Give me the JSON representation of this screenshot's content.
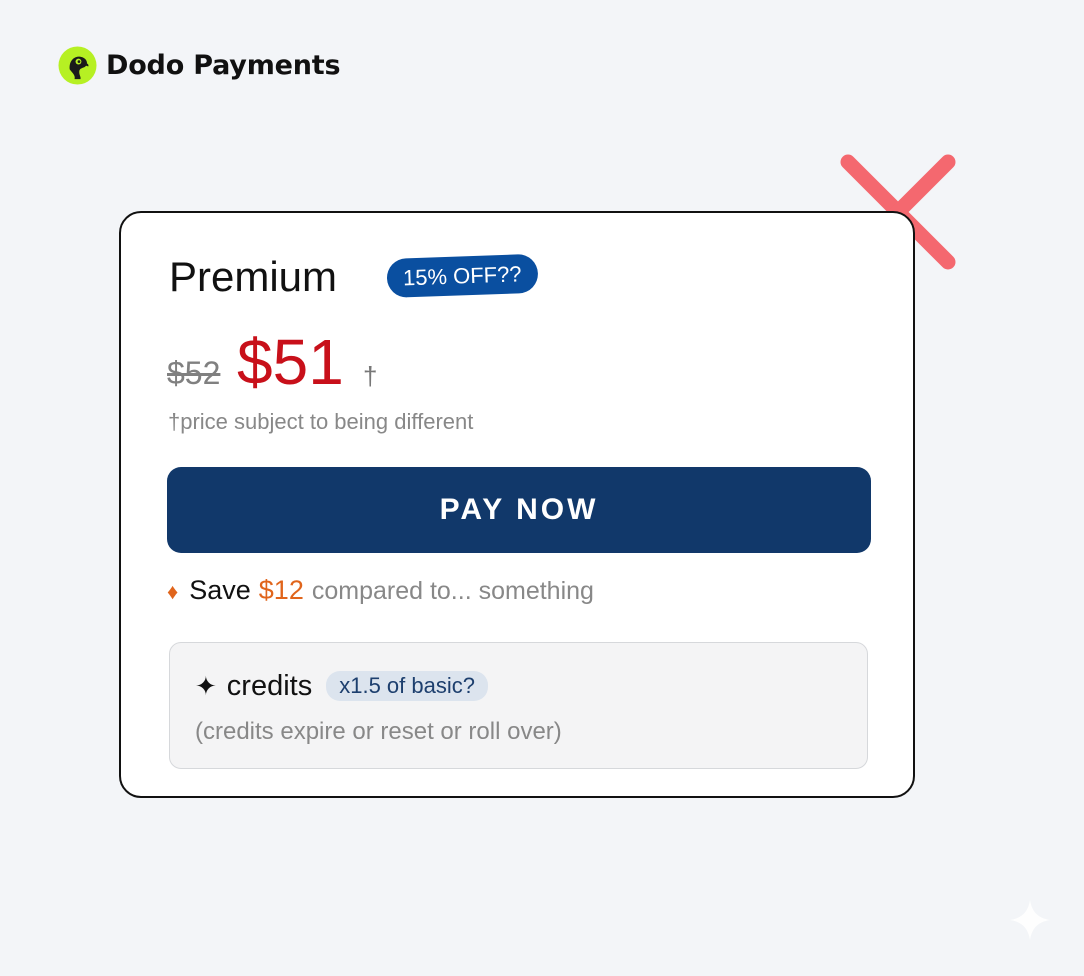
{
  "brand": {
    "name": "Dodo Payments",
    "logo_icon": "dodo-bird-logo-icon",
    "logo_color": "#b6f023"
  },
  "close": {
    "icon": "close-x-icon",
    "color": "#f4686f"
  },
  "plan": {
    "name": "Premium",
    "discount_badge": "15% OFF??",
    "old_price": "$52",
    "new_price": "$51",
    "price_marker": "†",
    "price_note": "†price subject to being different",
    "pay_button_label": "PAY NOW",
    "accent_color": "#11386a",
    "price_color": "#c8101a"
  },
  "savings": {
    "icon": "diamond-icon",
    "label": "Save",
    "amount": "$12",
    "comparison": "compared to... something",
    "color": "#e0651c"
  },
  "credits": {
    "icon": "sparkle-icon",
    "icon_glyph": "✦",
    "label": "credits",
    "multiplier": "x1.5 of basic?",
    "note": "(credits expire or reset or roll over)"
  }
}
